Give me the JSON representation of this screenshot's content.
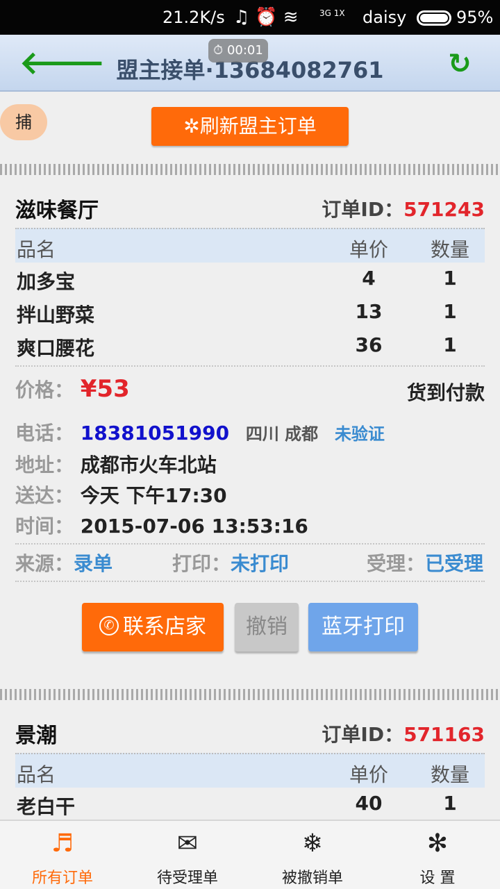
{
  "status_bar": {
    "speed": "21.2K/s",
    "carrier": "daisy",
    "battery": "95%",
    "network": "3G 1X"
  },
  "header": {
    "title": "盟主接单·13684082761",
    "timer": "00:01"
  },
  "capture_label": "捕",
  "refresh_button": "✲刷新盟主订单",
  "labels": {
    "item_name": "品名",
    "unit_price": "单价",
    "quantity": "数量",
    "order_id": "订单ID：",
    "price": "价格：",
    "phone": "电话：",
    "address": "地址：",
    "delivery": "送达：",
    "time": "时间：",
    "source": "来源：",
    "print": "打印：",
    "accept": "受理："
  },
  "orders": [
    {
      "shop": "滋味餐厅",
      "order_id": "571243",
      "items": [
        {
          "name": "加多宝",
          "price": "4",
          "qty": "1"
        },
        {
          "name": "拌山野菜",
          "price": "13",
          "qty": "1"
        },
        {
          "name": "爽口腰花",
          "price": "36",
          "qty": "1"
        }
      ],
      "total": "¥53",
      "payment": "货到付款",
      "phone": "18381051990",
      "region": "四川 成都",
      "verify": "未验证",
      "address": "成都市火车北站",
      "delivery": "今天 下午17:30",
      "time": "2015-07-06 13:53:16",
      "source": "录单",
      "print_status": "未打印",
      "accept_status": "已受理",
      "buttons": {
        "contact": "联系店家",
        "cancel": "撤销",
        "bt_print": "蓝牙打印"
      }
    },
    {
      "shop": "景潮",
      "order_id": "571163",
      "items": [
        {
          "name": "老白干",
          "price": "40",
          "qty": "1"
        }
      ]
    }
  ],
  "bottom_nav": [
    {
      "label": "所有订单",
      "icon": "music-note-icon",
      "active": true
    },
    {
      "label": "待受理单",
      "icon": "envelope-icon",
      "active": false
    },
    {
      "label": "被撤销单",
      "icon": "snowflake-icon",
      "active": false
    },
    {
      "label": "设 置",
      "icon": "asterisk-icon",
      "active": false
    }
  ],
  "colors": {
    "accent": "#ff6a0a",
    "price_red": "#e2252b",
    "link_blue": "#3a8bd0",
    "phone_blue": "#1111cc",
    "green": "#1a9a1a"
  }
}
